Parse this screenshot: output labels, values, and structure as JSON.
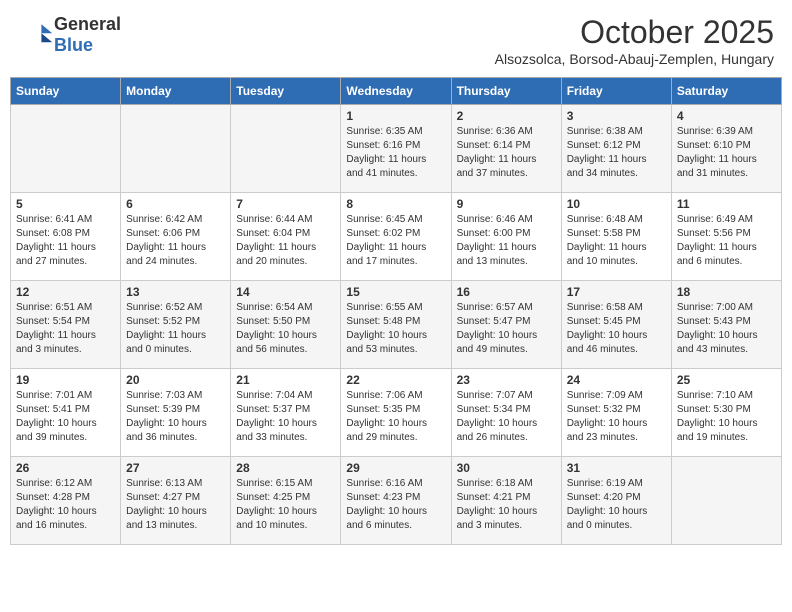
{
  "header": {
    "logo_general": "General",
    "logo_blue": "Blue",
    "month": "October 2025",
    "location": "Alsozsolca, Borsod-Abauj-Zemplen, Hungary"
  },
  "days_of_week": [
    "Sunday",
    "Monday",
    "Tuesday",
    "Wednesday",
    "Thursday",
    "Friday",
    "Saturday"
  ],
  "weeks": [
    [
      {
        "day": "",
        "info": ""
      },
      {
        "day": "",
        "info": ""
      },
      {
        "day": "",
        "info": ""
      },
      {
        "day": "1",
        "info": "Sunrise: 6:35 AM\nSunset: 6:16 PM\nDaylight: 11 hours\nand 41 minutes."
      },
      {
        "day": "2",
        "info": "Sunrise: 6:36 AM\nSunset: 6:14 PM\nDaylight: 11 hours\nand 37 minutes."
      },
      {
        "day": "3",
        "info": "Sunrise: 6:38 AM\nSunset: 6:12 PM\nDaylight: 11 hours\nand 34 minutes."
      },
      {
        "day": "4",
        "info": "Sunrise: 6:39 AM\nSunset: 6:10 PM\nDaylight: 11 hours\nand 31 minutes."
      }
    ],
    [
      {
        "day": "5",
        "info": "Sunrise: 6:41 AM\nSunset: 6:08 PM\nDaylight: 11 hours\nand 27 minutes."
      },
      {
        "day": "6",
        "info": "Sunrise: 6:42 AM\nSunset: 6:06 PM\nDaylight: 11 hours\nand 24 minutes."
      },
      {
        "day": "7",
        "info": "Sunrise: 6:44 AM\nSunset: 6:04 PM\nDaylight: 11 hours\nand 20 minutes."
      },
      {
        "day": "8",
        "info": "Sunrise: 6:45 AM\nSunset: 6:02 PM\nDaylight: 11 hours\nand 17 minutes."
      },
      {
        "day": "9",
        "info": "Sunrise: 6:46 AM\nSunset: 6:00 PM\nDaylight: 11 hours\nand 13 minutes."
      },
      {
        "day": "10",
        "info": "Sunrise: 6:48 AM\nSunset: 5:58 PM\nDaylight: 11 hours\nand 10 minutes."
      },
      {
        "day": "11",
        "info": "Sunrise: 6:49 AM\nSunset: 5:56 PM\nDaylight: 11 hours\nand 6 minutes."
      }
    ],
    [
      {
        "day": "12",
        "info": "Sunrise: 6:51 AM\nSunset: 5:54 PM\nDaylight: 11 hours\nand 3 minutes."
      },
      {
        "day": "13",
        "info": "Sunrise: 6:52 AM\nSunset: 5:52 PM\nDaylight: 11 hours\nand 0 minutes."
      },
      {
        "day": "14",
        "info": "Sunrise: 6:54 AM\nSunset: 5:50 PM\nDaylight: 10 hours\nand 56 minutes."
      },
      {
        "day": "15",
        "info": "Sunrise: 6:55 AM\nSunset: 5:48 PM\nDaylight: 10 hours\nand 53 minutes."
      },
      {
        "day": "16",
        "info": "Sunrise: 6:57 AM\nSunset: 5:47 PM\nDaylight: 10 hours\nand 49 minutes."
      },
      {
        "day": "17",
        "info": "Sunrise: 6:58 AM\nSunset: 5:45 PM\nDaylight: 10 hours\nand 46 minutes."
      },
      {
        "day": "18",
        "info": "Sunrise: 7:00 AM\nSunset: 5:43 PM\nDaylight: 10 hours\nand 43 minutes."
      }
    ],
    [
      {
        "day": "19",
        "info": "Sunrise: 7:01 AM\nSunset: 5:41 PM\nDaylight: 10 hours\nand 39 minutes."
      },
      {
        "day": "20",
        "info": "Sunrise: 7:03 AM\nSunset: 5:39 PM\nDaylight: 10 hours\nand 36 minutes."
      },
      {
        "day": "21",
        "info": "Sunrise: 7:04 AM\nSunset: 5:37 PM\nDaylight: 10 hours\nand 33 minutes."
      },
      {
        "day": "22",
        "info": "Sunrise: 7:06 AM\nSunset: 5:35 PM\nDaylight: 10 hours\nand 29 minutes."
      },
      {
        "day": "23",
        "info": "Sunrise: 7:07 AM\nSunset: 5:34 PM\nDaylight: 10 hours\nand 26 minutes."
      },
      {
        "day": "24",
        "info": "Sunrise: 7:09 AM\nSunset: 5:32 PM\nDaylight: 10 hours\nand 23 minutes."
      },
      {
        "day": "25",
        "info": "Sunrise: 7:10 AM\nSunset: 5:30 PM\nDaylight: 10 hours\nand 19 minutes."
      }
    ],
    [
      {
        "day": "26",
        "info": "Sunrise: 6:12 AM\nSunset: 4:28 PM\nDaylight: 10 hours\nand 16 minutes."
      },
      {
        "day": "27",
        "info": "Sunrise: 6:13 AM\nSunset: 4:27 PM\nDaylight: 10 hours\nand 13 minutes."
      },
      {
        "day": "28",
        "info": "Sunrise: 6:15 AM\nSunset: 4:25 PM\nDaylight: 10 hours\nand 10 minutes."
      },
      {
        "day": "29",
        "info": "Sunrise: 6:16 AM\nSunset: 4:23 PM\nDaylight: 10 hours\nand 6 minutes."
      },
      {
        "day": "30",
        "info": "Sunrise: 6:18 AM\nSunset: 4:21 PM\nDaylight: 10 hours\nand 3 minutes."
      },
      {
        "day": "31",
        "info": "Sunrise: 6:19 AM\nSunset: 4:20 PM\nDaylight: 10 hours\nand 0 minutes."
      },
      {
        "day": "",
        "info": ""
      }
    ]
  ]
}
